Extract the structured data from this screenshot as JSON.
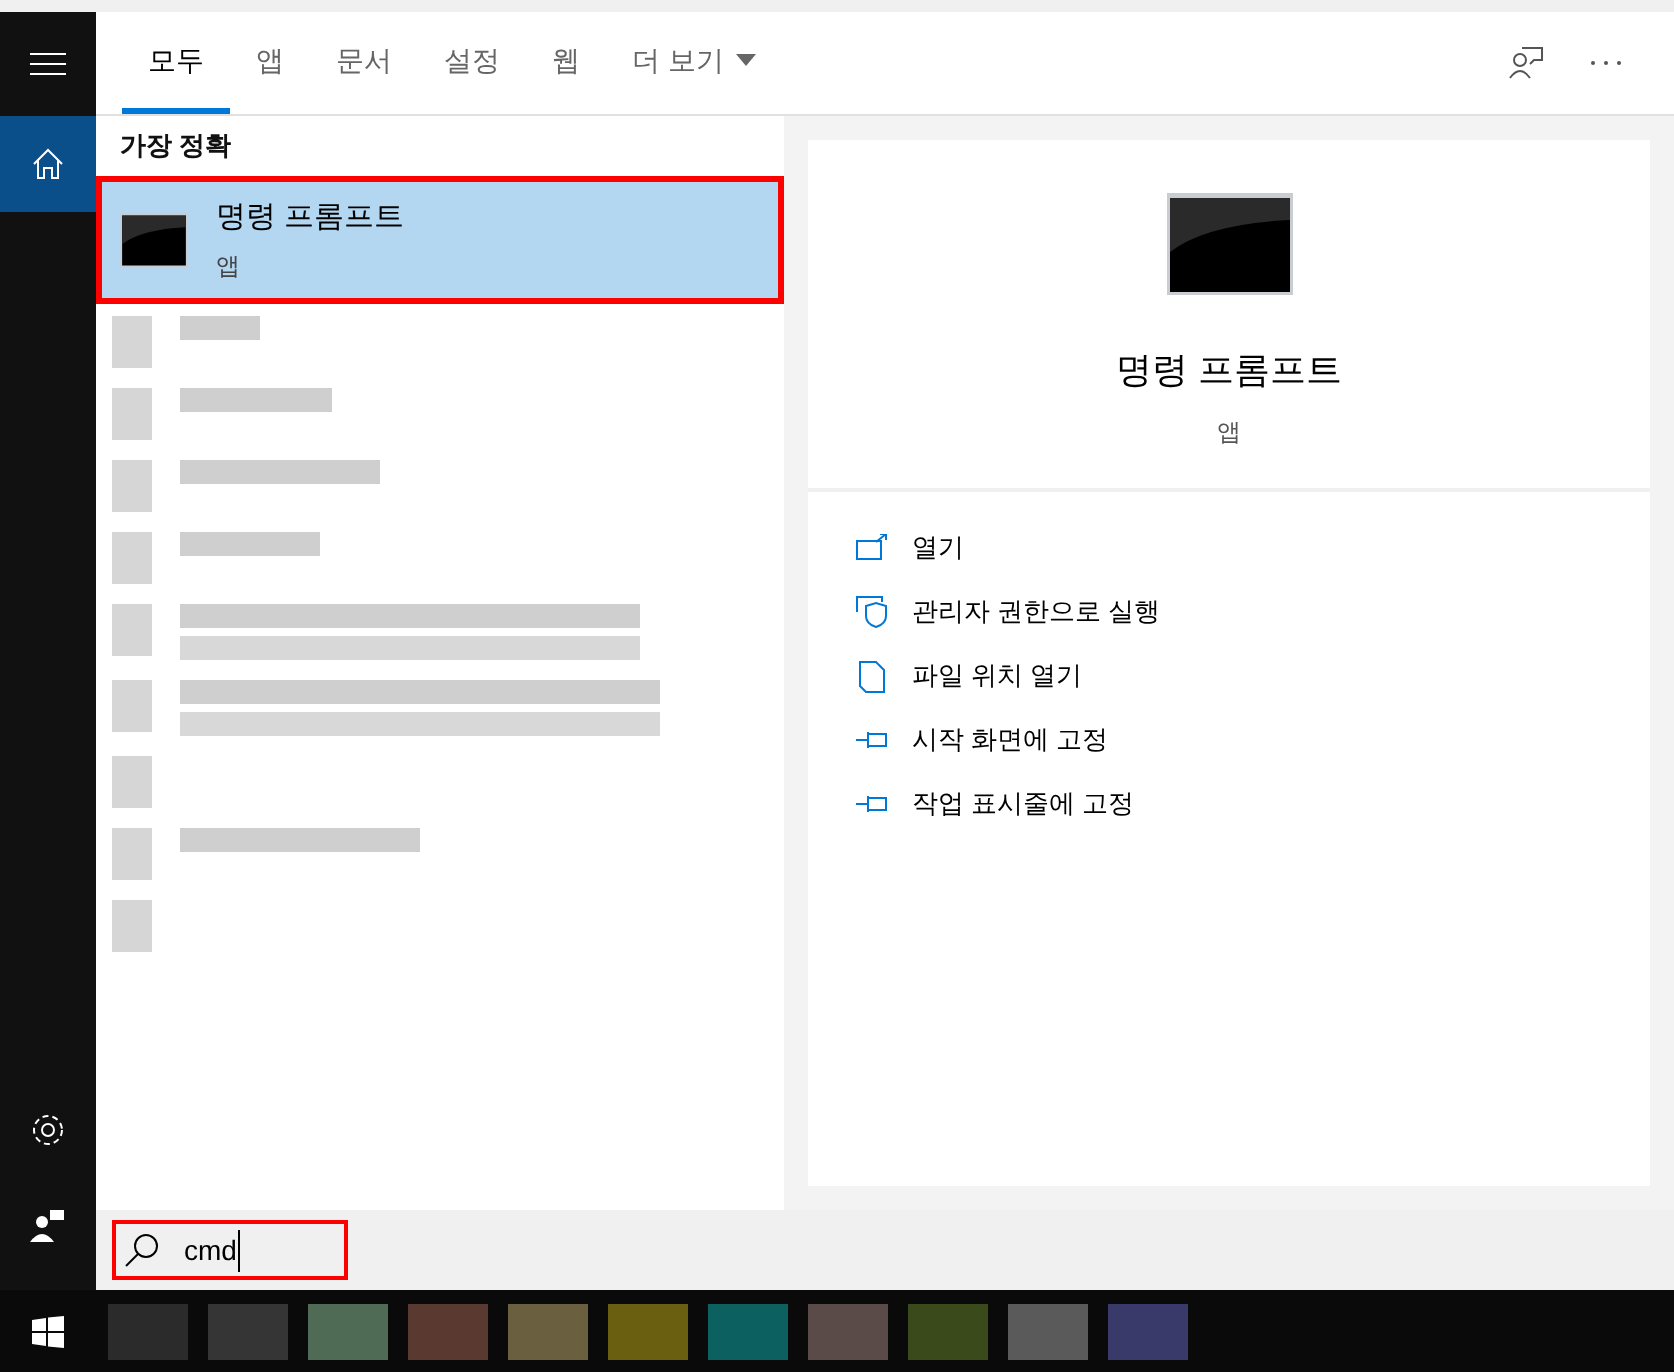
{
  "tabs": [
    {
      "label": "모두",
      "selected": true,
      "kind": "tab"
    },
    {
      "label": "앱",
      "selected": false,
      "kind": "tab"
    },
    {
      "label": "문서",
      "selected": false,
      "kind": "tab"
    },
    {
      "label": "설정",
      "selected": false,
      "kind": "tab"
    },
    {
      "label": "웹",
      "selected": false,
      "kind": "tab"
    },
    {
      "label": "더 보기",
      "selected": false,
      "kind": "dropdown"
    }
  ],
  "section_title": "가장 정확",
  "best_match": {
    "title": "명령 프롬프트",
    "subtitle": "앱",
    "selected": true
  },
  "detail": {
    "title": "명령 프롬프트",
    "subtitle": "앱",
    "actions": [
      {
        "label": "열기",
        "kind": "open"
      },
      {
        "label": "관리자 권한으로 실행",
        "kind": "admin"
      },
      {
        "label": "파일 위치 열기",
        "kind": "folder"
      },
      {
        "label": "시작 화면에 고정",
        "kind": "pin"
      },
      {
        "label": "작업 표시줄에 고정",
        "kind": "pin"
      }
    ]
  },
  "search": {
    "value": "cmd"
  }
}
